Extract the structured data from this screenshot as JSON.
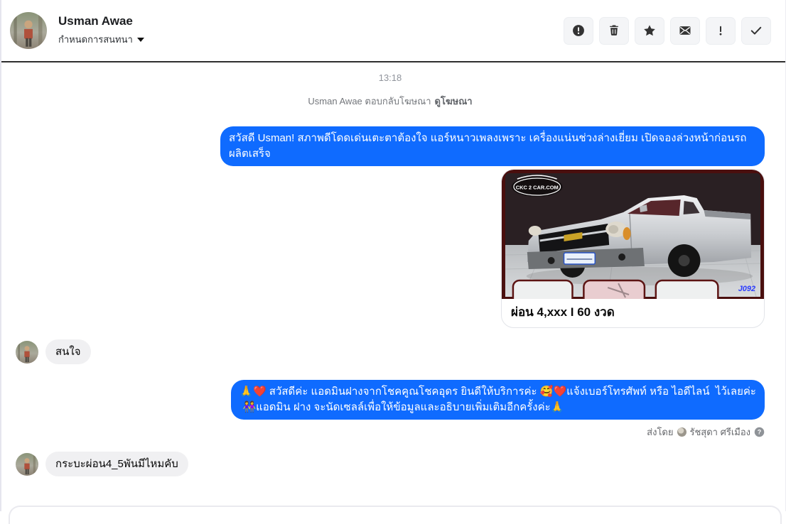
{
  "header": {
    "contact_name": "Usman Awae",
    "conversation_label": "กำหนดการสนทนา",
    "actions": [
      {
        "icon": "report-circle-icon"
      },
      {
        "icon": "trash-icon"
      },
      {
        "icon": "star-icon"
      },
      {
        "icon": "unread-envelope-icon"
      },
      {
        "icon": "exclamation-icon"
      },
      {
        "icon": "check-icon"
      }
    ]
  },
  "chat": {
    "time": "13:18",
    "ad_notice": {
      "text": "Usman Awae ตอบกลับโฆษณา",
      "link_label": "ดูโฆษณา"
    },
    "outgoing_greeting": "สวัสดี Usman! สภาพดีโดดเด่นเตะตาต้องใจ แอร์หนาวเพลงเพราะ เครื่องแน่นช่วงล่างเยี่ยม เปิดจองล่วงหน้าก่อนรถผลิตเสร็จ",
    "attachment": {
      "caption": "ผ่อน 4,xxx I 60 งวด",
      "watermark": "CKC 2 CAR.COM",
      "photo_code": "J092"
    },
    "incoming_interest": "สนใจ",
    "outgoing_admin": "🙏❤️ สวัสดีค่ะ แอดมินฝางจากโชคคูณโชคอุดร ยินดีให้บริการค่ะ 🥰❤️แจ้งเบอร์โทรศัพท์ หรือ ไอดีไลน์  ไว้เลยค่ะ\n 👭แอดมิน ฝาง จะนัดเซลล์เพื่อให้ข้อมูลและอธิบายเพิ่มเติมอีกครั้งค่ะ🙏",
    "sent_by": {
      "label": "ส่งโดย",
      "name": "รัชสุดา ศรีเมือง"
    },
    "incoming_question": "กระบะผ่อน4_5พันมีไหมคับ"
  },
  "colors": {
    "outgoing_bubble": "#0f6bff",
    "incoming_bubble": "#f0f0f2",
    "header_divider": "#2e2e2e"
  }
}
